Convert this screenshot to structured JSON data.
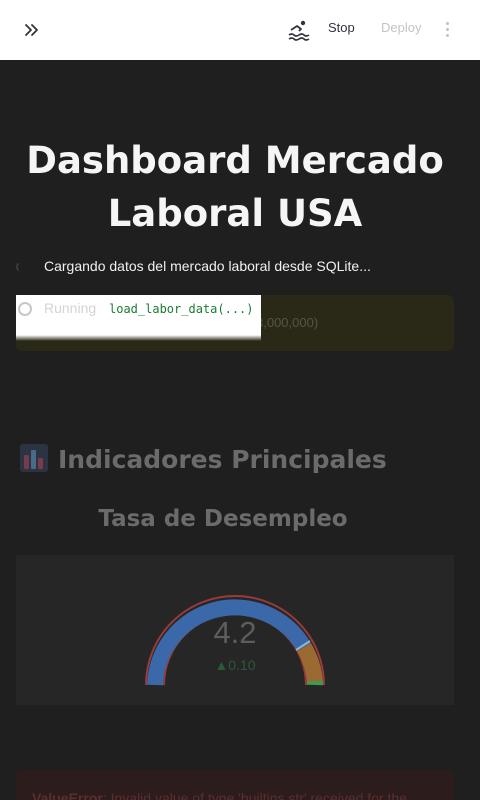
{
  "header": {
    "expand_icon": "double-chevron-right-icon",
    "running_icon": "swimmer-icon",
    "stop_label": "Stop",
    "deploy_label": "Deploy",
    "menu_icon": "vertical-dots-icon"
  },
  "page": {
    "title": "Dashboard Mercado Laboral USA"
  },
  "status": {
    "spinner_text": "Cargando datos del mercado laboral desde SQLite...",
    "running_label": "Running",
    "running_code": "load_labor_data(...)",
    "info_text": "3,000,000)"
  },
  "section": {
    "icon": "bar-chart-icon",
    "title": "Indicadores Principales",
    "subtitle": "Tasa de Desempleo"
  },
  "gauge": {
    "value": "4.2",
    "delta": "▲0.10",
    "colors": {
      "fill": "#3a68a8",
      "outline": "#c24848",
      "warn": "#b8772f",
      "ok": "#3f9a4b",
      "needle": "#8fb6d8",
      "delta": "#2c5a38"
    }
  },
  "error": {
    "type": "ValueError",
    "message": ": Invalid value of type 'builtins.str' received for the"
  }
}
